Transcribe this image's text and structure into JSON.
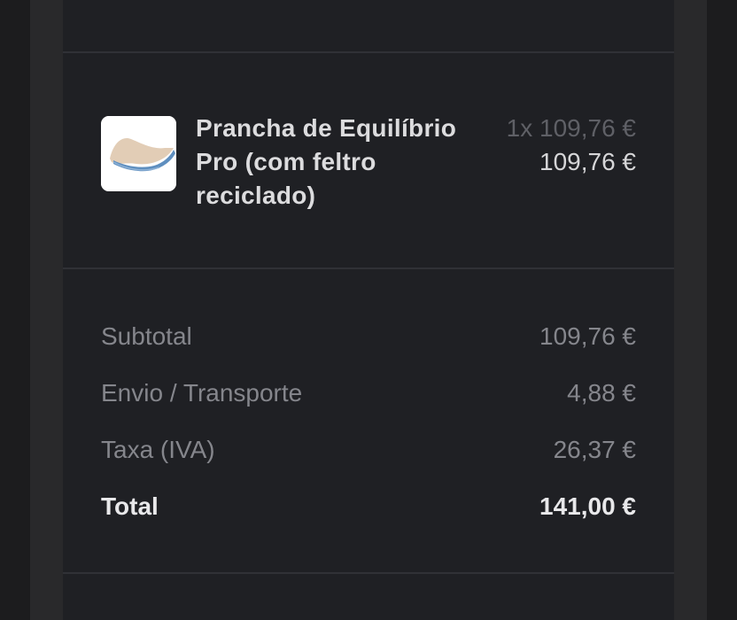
{
  "order_item": {
    "image_alt": "balance-board-image",
    "title": "Prancha de Equilíbrio\nPro (com feltro\nreciclado)",
    "quantity_price": "1x 109,76 €",
    "line_total": "109,76 €"
  },
  "summary": {
    "subtotal_label": "Subtotal",
    "subtotal_value": "109,76 €",
    "shipping_label": "Envio / Transporte",
    "shipping_value": "4,88 €",
    "tax_label": "Taxa (IVA)",
    "tax_value": "26,37 €",
    "total_label": "Total",
    "total_value": "141,00 €"
  }
}
